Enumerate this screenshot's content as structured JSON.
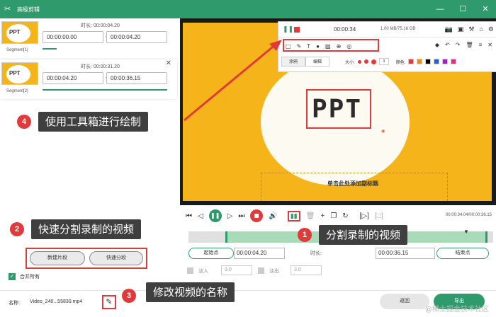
{
  "window": {
    "title": "高级剪辑"
  },
  "segments": [
    {
      "label": "Segment[1]",
      "thumb_text": "PPT",
      "duration_label": "时长: 00:00:04.20",
      "start": "00:00:00.00",
      "end": "00:00:04.20"
    },
    {
      "label": "Segment[2]",
      "thumb_text": "PPT",
      "duration_label": "时长: 00:00:31.20",
      "start": "00:00:04.20",
      "end": "00:00:36.15"
    }
  ],
  "tilde": "~",
  "callouts": {
    "c1": {
      "num": "1",
      "text": "分割录制的视频"
    },
    "c2": {
      "num": "2",
      "text": "快速分割录制的视频"
    },
    "c3": {
      "num": "3",
      "text": "修改视频的名称"
    },
    "c4": {
      "num": "4",
      "text": "使用工具箱进行绘制"
    }
  },
  "left_buttons": {
    "new_segment": "新建片段",
    "quick_split": "快速分段"
  },
  "merge": {
    "label": "合并所有"
  },
  "bottom": {
    "name_label": "名称:",
    "name_value": "Video_240...55830.mp4",
    "back": "返回",
    "export": "导出"
  },
  "preview": {
    "slide_title": "PPT",
    "slide_subtitle": "单击此处添加副标题",
    "toolbar": {
      "time": "00:00:34",
      "size": "1.00 MB/75.16 GB",
      "tab_draw": "涂鸦",
      "tab_edit": "编辑",
      "size_label": "大小:",
      "size_value": "3",
      "color_label": "颜色:"
    }
  },
  "playback": {
    "time": "00:00:34.04/00:00:36.15"
  },
  "trim": {
    "start_btn": "起始点",
    "start_value": "00:00:04.20",
    "dur_label": "时长:",
    "end_value": "00:00:36.15",
    "end_btn": "结束点"
  },
  "fade": {
    "in_label": "淡入",
    "in_value": "3.0",
    "out_label": "淡出",
    "out_value": "3.0"
  },
  "watermark": "@稀土掘金技术社区",
  "colors": {
    "accent": "#2f9a6c",
    "red": "#e03a3a",
    "callout_bg": "#3f3f3f",
    "slide_bg": "#f5b41a"
  }
}
